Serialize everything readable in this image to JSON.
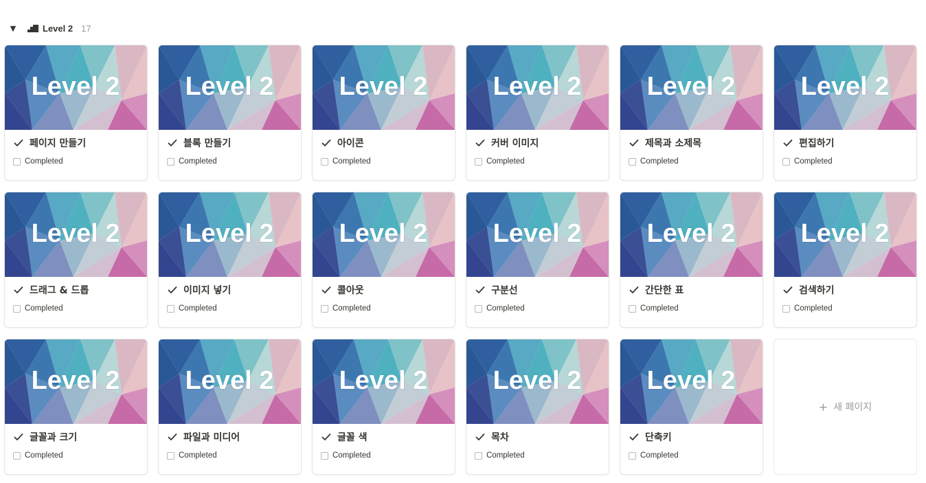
{
  "group": {
    "title": "Level 2",
    "count": "17",
    "toggle_icon": "triangle-down-icon",
    "group_icon": "stairs-icon"
  },
  "cover": {
    "text": "Level 2",
    "colors": [
      "#2f5f9f",
      "#4fb0c0",
      "#b7d8d6",
      "#e7c3c7",
      "#c66aa8"
    ]
  },
  "cards": [
    {
      "title": "페이지 만들기",
      "prop_label": "Completed"
    },
    {
      "title": "블록 만들기",
      "prop_label": "Completed"
    },
    {
      "title": "아이콘",
      "prop_label": "Completed"
    },
    {
      "title": "커버 이미지",
      "prop_label": "Completed"
    },
    {
      "title": "제목과 소제목",
      "prop_label": "Completed"
    },
    {
      "title": "편집하기",
      "prop_label": "Completed"
    },
    {
      "title": "드래그 & 드롭",
      "prop_label": "Completed"
    },
    {
      "title": "이미지 넣기",
      "prop_label": "Completed"
    },
    {
      "title": "콜아웃",
      "prop_label": "Completed"
    },
    {
      "title": "구분선",
      "prop_label": "Completed"
    },
    {
      "title": "간단한 표",
      "prop_label": "Completed"
    },
    {
      "title": "검색하기",
      "prop_label": "Completed"
    },
    {
      "title": "글꼴과 크기",
      "prop_label": "Completed"
    },
    {
      "title": "파일과 미디어",
      "prop_label": "Completed"
    },
    {
      "title": "글꼴 색",
      "prop_label": "Completed"
    },
    {
      "title": "목차",
      "prop_label": "Completed"
    },
    {
      "title": "단축키",
      "prop_label": "Completed"
    }
  ],
  "new_page": {
    "label": "새 페이지",
    "icon": "plus-icon"
  }
}
